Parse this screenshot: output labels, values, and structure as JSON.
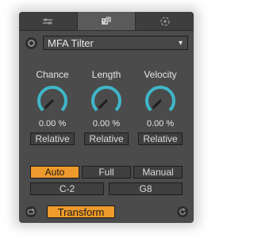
{
  "device": {
    "preset": {
      "value": "MFA Tilter",
      "arrow": "▾"
    },
    "tabs": [
      {
        "icon": "sliders-icon",
        "active": false
      },
      {
        "icon": "dice-icon",
        "active": true
      },
      {
        "icon": "target-icon",
        "active": false
      }
    ],
    "knobs": [
      {
        "label": "Chance",
        "value": "0.00 %",
        "mode": "Relative",
        "level": 0.0
      },
      {
        "label": "Length",
        "value": "0.00 %",
        "mode": "Relative",
        "level": 0.0
      },
      {
        "label": "Velocity",
        "value": "0.00 %",
        "mode": "Relative",
        "level": 0.0
      }
    ],
    "modes": [
      {
        "label": "Auto",
        "active": true
      },
      {
        "label": "Full",
        "active": false
      },
      {
        "label": "Manual",
        "active": false
      }
    ],
    "range": {
      "low": "C-2",
      "high": "G8"
    },
    "transform_label": "Transform",
    "colors": {
      "accent": "#ef9a2c",
      "knob_arc": "#3fb6c9",
      "panel": "#4b4b4b"
    }
  }
}
